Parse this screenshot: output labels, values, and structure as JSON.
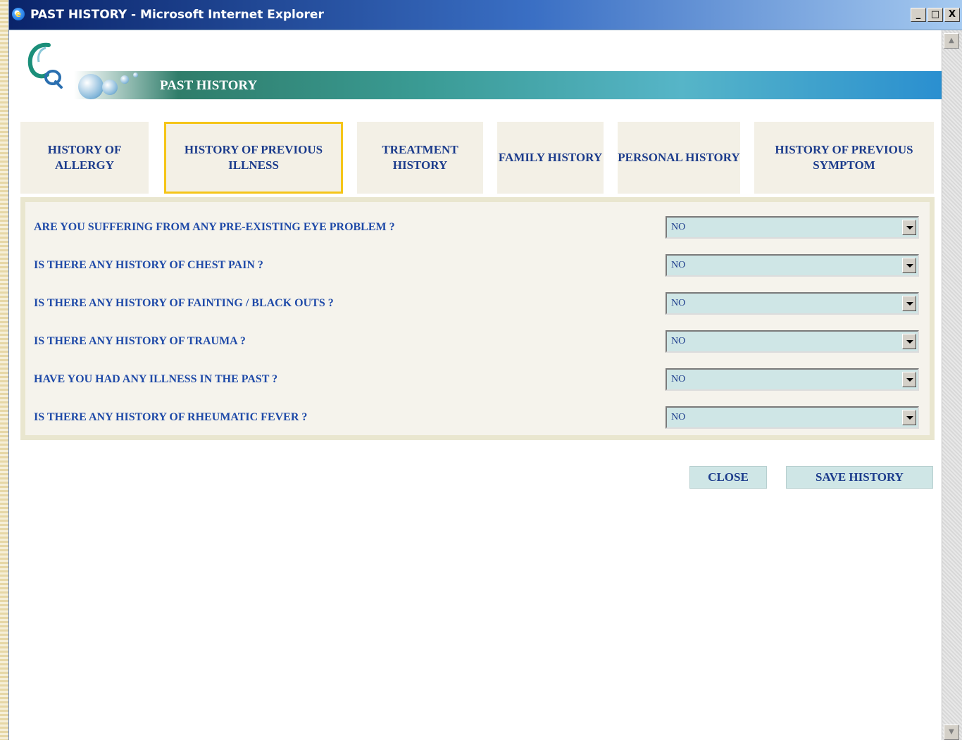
{
  "window": {
    "title": "PAST HISTORY - Microsoft Internet Explorer",
    "controls": {
      "minimize": "_",
      "maximize": "□",
      "close": "X"
    }
  },
  "banner": {
    "title": "PAST HISTORY"
  },
  "tabs": [
    {
      "label": "HISTORY OF ALLERGY",
      "active": false
    },
    {
      "label": "HISTORY OF PREVIOUS ILLNESS",
      "active": true
    },
    {
      "label": "TREATMENT HISTORY",
      "active": false
    },
    {
      "label": "FAMILY HISTORY",
      "active": false
    },
    {
      "label": "PERSONAL HISTORY",
      "active": false
    },
    {
      "label": "HISTORY OF PREVIOUS SYMPTOM",
      "active": false
    }
  ],
  "questions": [
    {
      "label": "ARE YOU SUFFERING FROM ANY PRE-EXISTING EYE PROBLEM ?",
      "value": "NO"
    },
    {
      "label": "IS THERE ANY HISTORY OF CHEST PAIN ?",
      "value": "NO"
    },
    {
      "label": "IS THERE ANY HISTORY OF FAINTING / BLACK OUTS ?",
      "value": "NO"
    },
    {
      "label": "IS THERE ANY HISTORY OF TRAUMA ?",
      "value": "NO"
    },
    {
      "label": "HAVE YOU HAD ANY ILLNESS IN THE PAST ?",
      "value": "NO"
    },
    {
      "label": "IS THERE ANY HISTORY OF RHEUMATIC FEVER ?",
      "value": "NO"
    }
  ],
  "buttons": {
    "close": "CLOSE",
    "save": "SAVE HISTORY"
  },
  "colors": {
    "label_text": "#1f4aa8",
    "select_bg": "#cfe6e6",
    "active_tab_border": "#f5c518"
  }
}
